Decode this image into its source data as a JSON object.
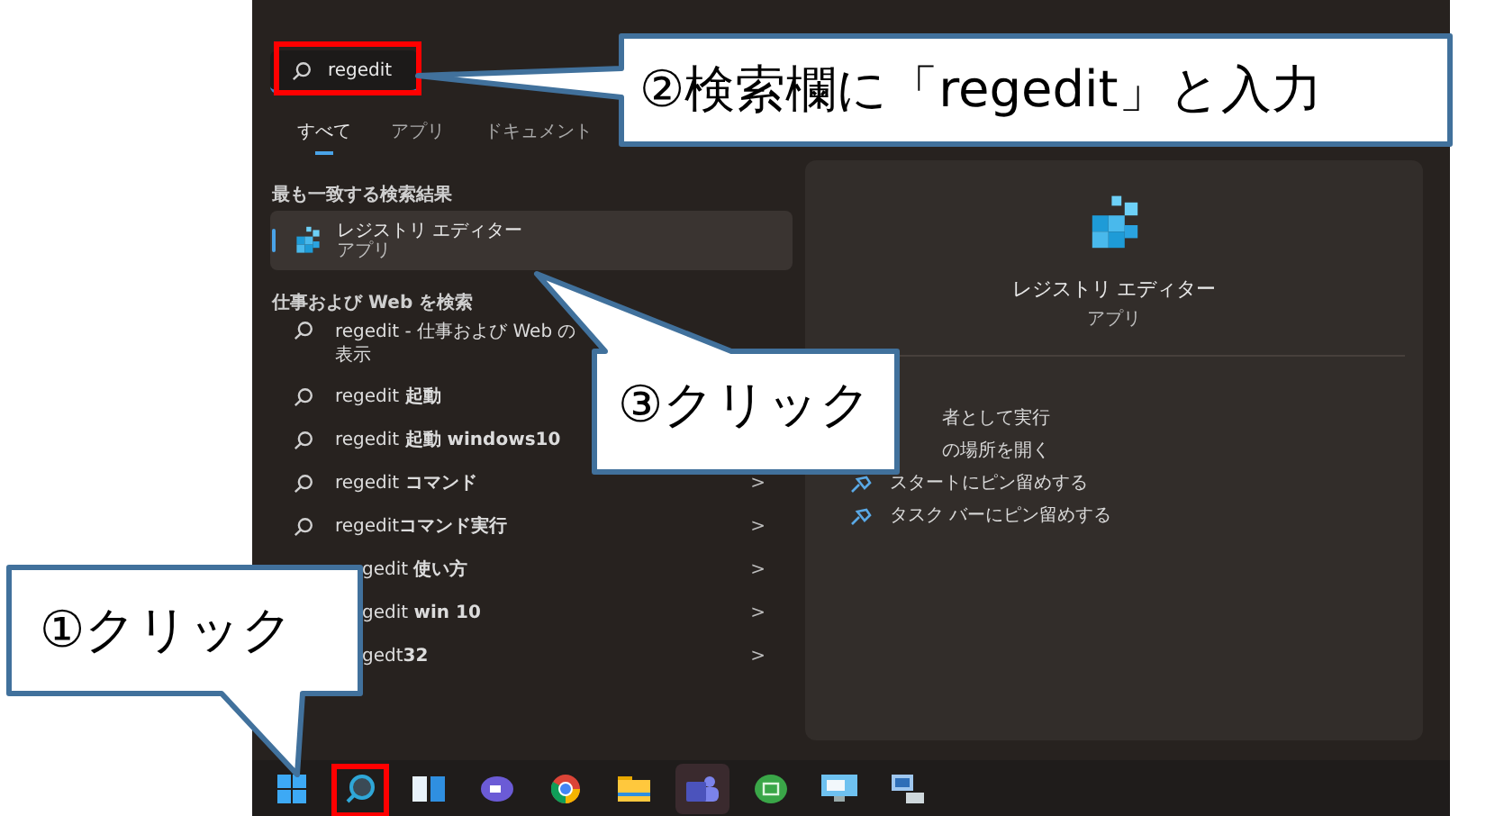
{
  "search": {
    "value": "regedit"
  },
  "tabs": [
    {
      "label": "すべて",
      "selected": true
    },
    {
      "label": "アプリ",
      "selected": false
    },
    {
      "label": "ドキュメント",
      "selected": false
    }
  ],
  "best_match": {
    "heading": "最も一致する検索結果",
    "title": "レジストリ エディター",
    "subtitle": "アプリ",
    "selected": true
  },
  "web_search": {
    "heading": "仕事および Web を検索",
    "items": [
      {
        "text": "regedit - 仕事および Web の",
        "text_2": "表示",
        "icon": true
      },
      {
        "text": "regedit **起動**",
        "icon": true
      },
      {
        "text": "regedit **起動 windows10**",
        "icon": true
      },
      {
        "text": "regedit **コマンド**",
        "icon": true,
        "arrow": ">"
      },
      {
        "text": "regedit**コマンド実行**",
        "icon": true,
        "arrow": ">"
      },
      {
        "text": "gedit **使い方**",
        "icon": false,
        "arrow": ">"
      },
      {
        "text": "gedit **win 10**",
        "icon": false,
        "arrow": ">"
      },
      {
        "text": "gedt**32**",
        "icon": false,
        "arrow": ">"
      }
    ]
  },
  "preview": {
    "title": "レジストリ エディター",
    "subtitle": "アプリ",
    "actions": [
      {
        "text": "者として実行",
        "icon": false
      },
      {
        "text": "の場所を開く",
        "icon": false
      },
      {
        "text": "スタートにピン留めする",
        "icon": true
      },
      {
        "text": "タスク バーにピン留めする",
        "icon": true
      }
    ]
  },
  "taskbar": [
    {
      "kind": "start",
      "highlighted": false
    },
    {
      "kind": "search",
      "highlighted": true
    },
    {
      "kind": "widgets",
      "highlighted": false
    },
    {
      "kind": "chat",
      "highlighted": false
    },
    {
      "kind": "browser",
      "highlighted": false
    },
    {
      "kind": "folder",
      "highlighted": false
    },
    {
      "kind": "teams",
      "highlighted": false
    },
    {
      "kind": "green",
      "highlighted": false
    },
    {
      "kind": "screen",
      "highlighted": false
    },
    {
      "kind": "network",
      "highlighted": false
    }
  ],
  "callouts": [
    {
      "text": "②検索欄に「regedit」と入力"
    },
    {
      "text": "③クリック"
    },
    {
      "text": "①クリック"
    }
  ]
}
